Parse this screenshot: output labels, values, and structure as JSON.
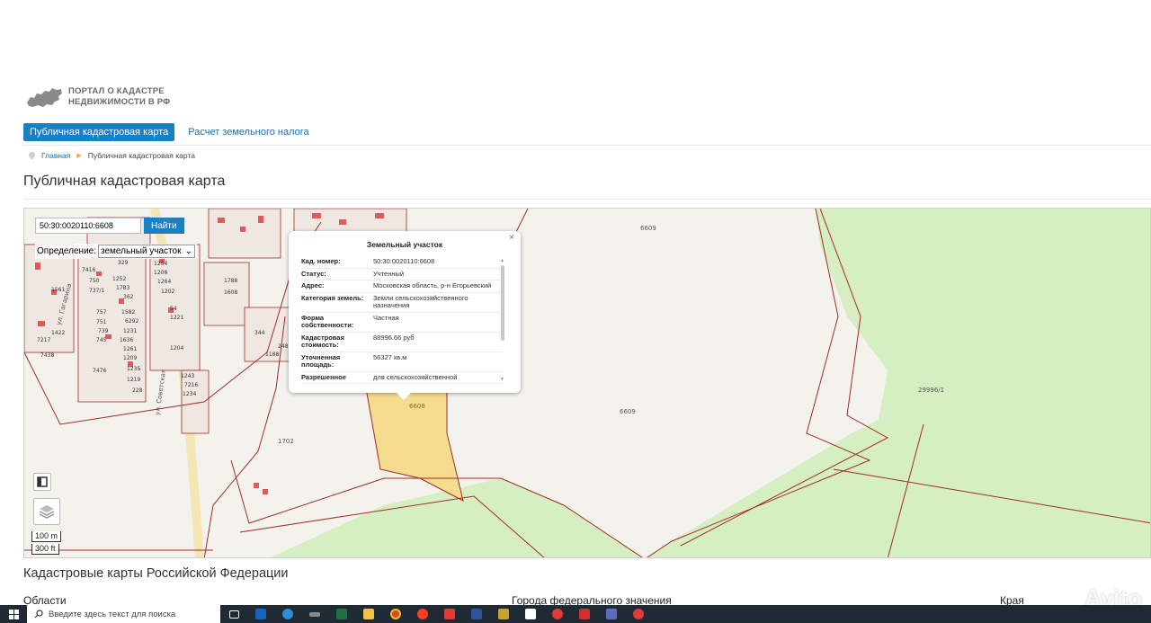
{
  "header": {
    "logo_line1": "ПОРТАЛ О КАДАСТРЕ",
    "logo_line2": "НЕДВИЖИМОСТИ В РФ"
  },
  "nav": {
    "active_tab": "Публичная кадастровая карта",
    "tab2": "Расчет земельного налога"
  },
  "breadcrumb": {
    "home": "Главная",
    "current": "Публичная кадастровая карта"
  },
  "page_title": "Публичная кадастровая карта",
  "map": {
    "search_value": "50:30:0020110:6608",
    "search_button": "Найти",
    "define_label": "Определение:",
    "define_value": "земельный участок",
    "scale_metric": "100 m",
    "scale_imperial": "300 ft",
    "labels": {
      "l6609a": "6609",
      "l6609b": "6609",
      "l6608": "6608",
      "l29996": "29996/1",
      "l1702": "1702",
      "street1": "ул. Гагарина",
      "street2": "ул. Советская"
    },
    "plot_numbers": [
      "7416",
      "750",
      "1252",
      "1254",
      "1206",
      "737/1",
      "1783",
      "1264",
      "362",
      "1202",
      "757",
      "1582",
      "54",
      "751",
      "6292",
      "1221",
      "739",
      "1231",
      "745",
      "1636",
      "1261",
      "1204",
      "1209",
      "1235",
      "7476",
      "1219",
      "228",
      "1243",
      "7216",
      "1234",
      "1788",
      "1608",
      "344",
      "248",
      "1188",
      "7217",
      "1422",
      "7438",
      "329",
      "1561"
    ]
  },
  "popup": {
    "title": "Земельный участок",
    "close": "×",
    "rows": [
      {
        "k": "Кад. номер:",
        "v": "50:30:0020110:6608"
      },
      {
        "k": "Статус:",
        "v": "Учтенный"
      },
      {
        "k": "Адрес:",
        "v": "Московская область, р-н Егорьевский"
      },
      {
        "k": "Категория земель:",
        "v": "Земли сельскохозяйственного назначения"
      },
      {
        "k": "Форма собственности:",
        "v": "Частная"
      },
      {
        "k": "Кадастровая стоимость:",
        "v": "88996.66 руб"
      },
      {
        "k": "Уточненная площадь:",
        "v": "56327 кв.м"
      },
      {
        "k": "Разрешенное",
        "v": "для сельскохозяйственной"
      }
    ]
  },
  "section_title": "Кадастровые карты Российской Федерации",
  "subheads": {
    "left": "Области",
    "middle": "Города федерального значения",
    "right": "Края"
  },
  "taskbar": {
    "search_placeholder": "Введите здесь текст для поиска"
  },
  "watermark": "Avito",
  "colors": {
    "accent": "#1b7fc3",
    "parcel_border": "#a52a2a",
    "selected_parcel": "#f5dc8e",
    "forest": "#d6efc2"
  }
}
